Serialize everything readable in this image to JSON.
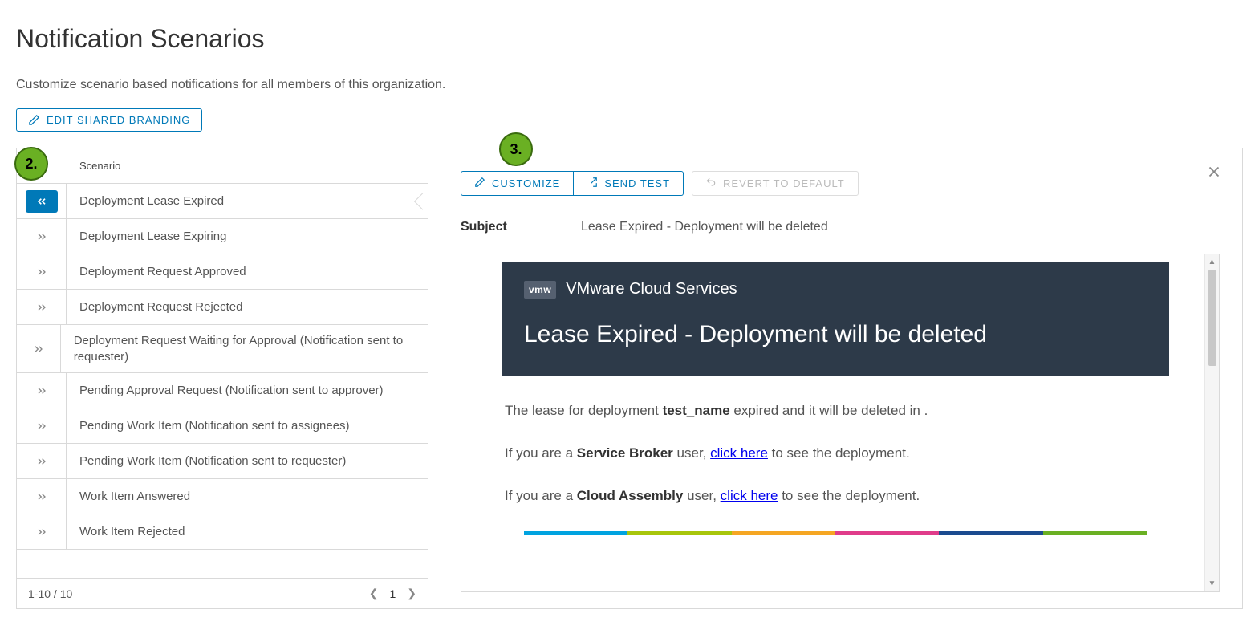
{
  "page": {
    "title": "Notification Scenarios",
    "subtitle": "Customize scenario based notifications for all members of this organization.",
    "edit_branding": "EDIT SHARED BRANDING"
  },
  "annotations": {
    "b2": "2.",
    "b3": "3."
  },
  "list": {
    "header": "Scenario",
    "items": [
      {
        "label": "Deployment Lease Expired",
        "selected": true
      },
      {
        "label": "Deployment Lease Expiring"
      },
      {
        "label": "Deployment Request Approved"
      },
      {
        "label": "Deployment Request Rejected"
      },
      {
        "label": "Deployment Request Waiting for Approval (Notification sent to requester)"
      },
      {
        "label": "Pending Approval Request (Notification sent to approver)"
      },
      {
        "label": "Pending Work Item (Notification sent to assignees)"
      },
      {
        "label": "Pending Work Item (Notification sent to requester)"
      },
      {
        "label": "Work Item Answered"
      },
      {
        "label": "Work Item Rejected"
      }
    ],
    "pager": {
      "range": "1-10 / 10",
      "page": "1"
    }
  },
  "detail": {
    "toolbar": {
      "customize": "CUSTOMIZE",
      "send_test": "SEND TEST",
      "revert": "REVERT TO DEFAULT"
    },
    "subject_label": "Subject",
    "subject_value": "Lease Expired - Deployment will be deleted",
    "brand_box": "vmw",
    "brand_name": "VMware Cloud Services",
    "email_title": "Lease Expired - Deployment will be deleted",
    "body": {
      "p1_a": "The lease for deployment ",
      "p1_b": "test_name",
      "p1_c": " expired and it will be deleted in .",
      "p2_a": "If you are a ",
      "p2_b": "Service Broker",
      "p2_c": " user, ",
      "p2_link": "click here",
      "p2_d": " to see the deployment.",
      "p3_a": "If you are a ",
      "p3_b": "Cloud Assembly",
      "p3_c": " user, ",
      "p3_link": "click here",
      "p3_d": " to see the deployment."
    },
    "rainbow": [
      "#00a3e0",
      "#a8c60c",
      "#f5a623",
      "#e03c8a",
      "#1b4b8f",
      "#6ab023"
    ]
  }
}
